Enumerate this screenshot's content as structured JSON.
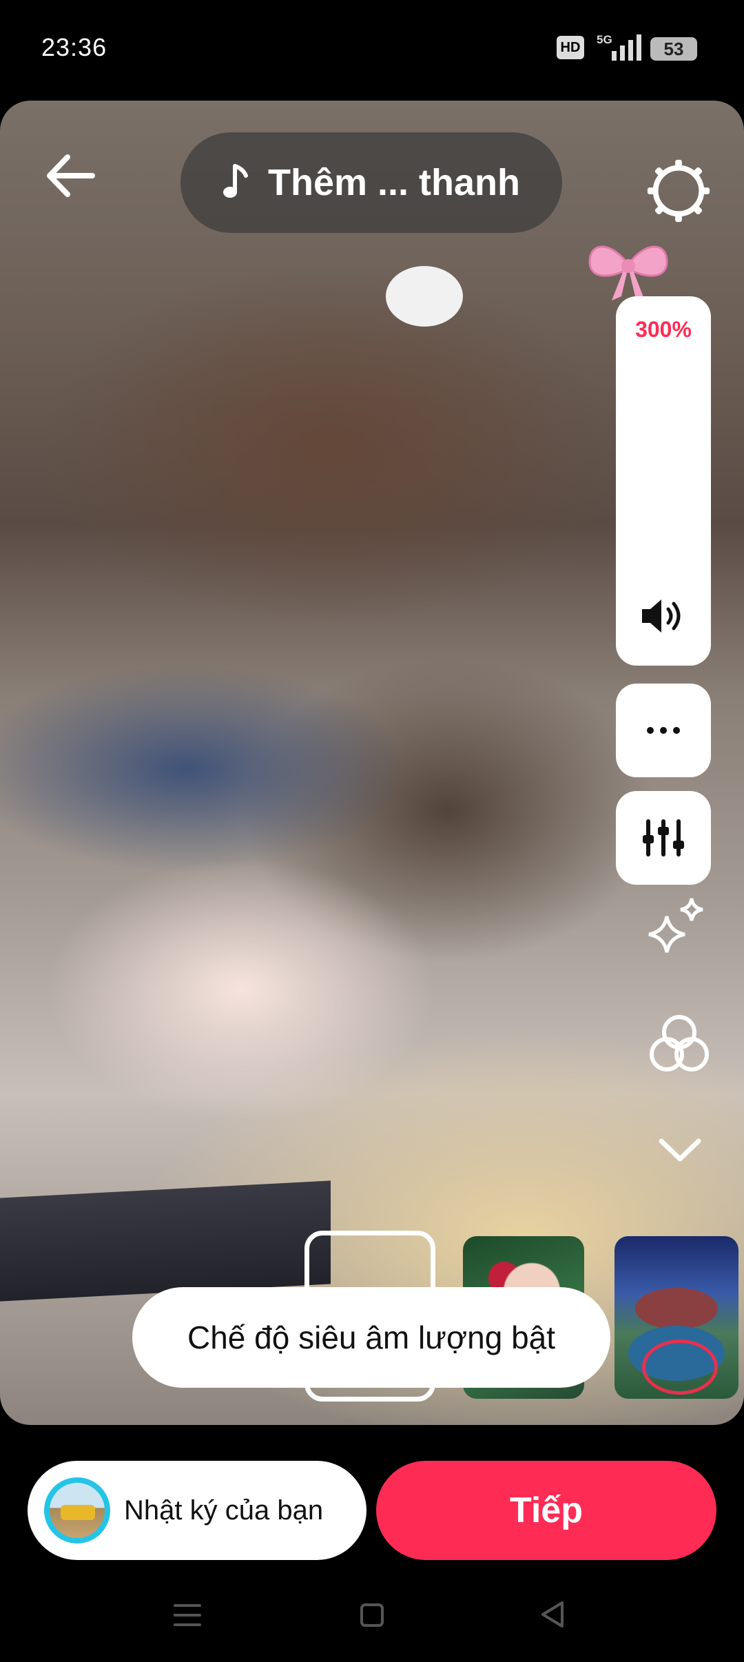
{
  "status_bar": {
    "time": "23:36",
    "hd": "HD",
    "network": "5G",
    "battery": "53"
  },
  "top_bar": {
    "add_sound_label": "Thêm ... thanh"
  },
  "volume": {
    "percent_label": "300%",
    "level_fraction": 1.0
  },
  "toast": {
    "message": "Chế độ siêu âm lượng bật"
  },
  "bottom": {
    "story_label": "Nhật ký của bạn",
    "next_label": "Tiếp"
  },
  "colors": {
    "accent": "#fe2c55",
    "avatar_ring": "#25c4e6"
  },
  "icons": [
    "back-arrow-icon",
    "music-note-icon",
    "gear-icon",
    "bow-sticker-icon",
    "speaker-icon",
    "more-dots-icon",
    "mixer-icon",
    "sparkle-icon",
    "circles-icon",
    "chevron-down-icon",
    "menu-icon",
    "home-icon",
    "back-triangle-icon"
  ]
}
